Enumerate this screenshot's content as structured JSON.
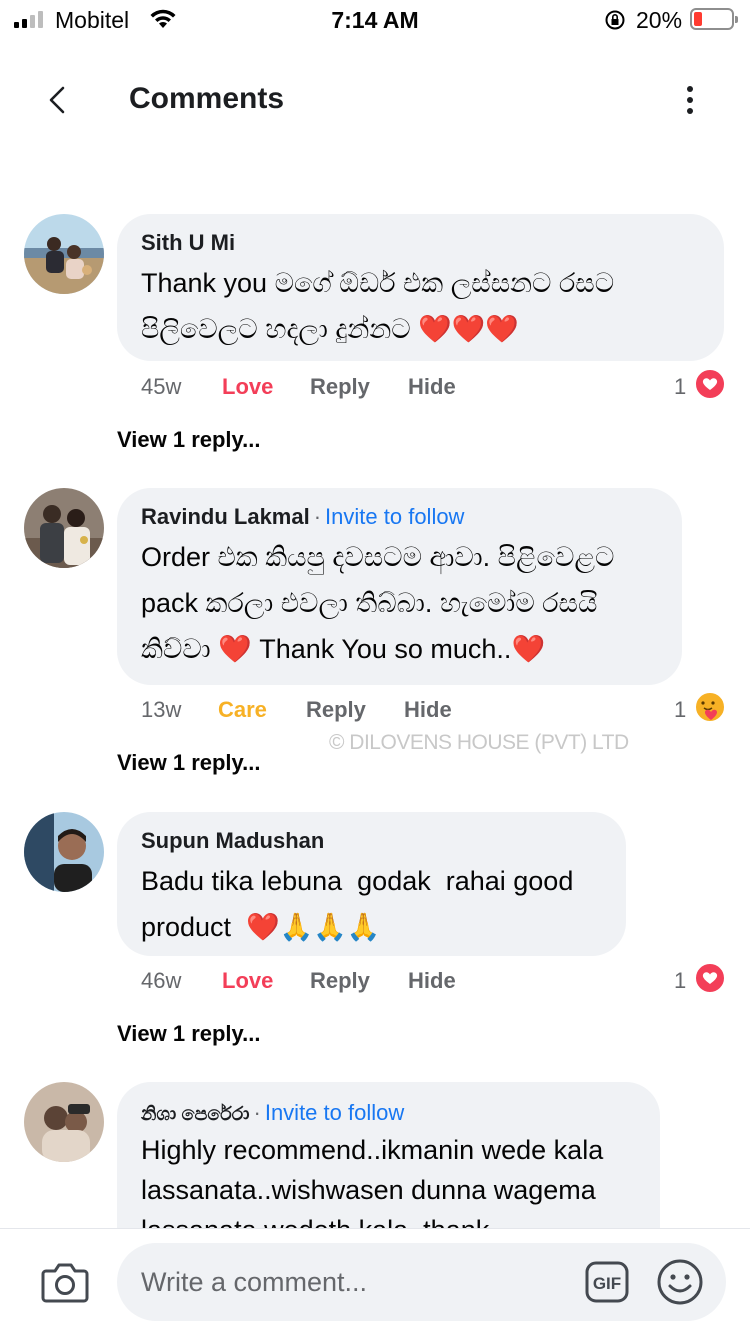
{
  "status_bar": {
    "carrier": "Mobitel",
    "time": "7:14 AM",
    "battery_percent": "20%",
    "battery_level": 0.2,
    "battery_color": "#ff3b30",
    "icons": [
      "signal-icon",
      "wifi-icon",
      "rotation-lock-icon",
      "battery-icon"
    ]
  },
  "header": {
    "title": "Comments",
    "icons": [
      "back-chevron-icon",
      "more-vertical-icon"
    ]
  },
  "comments": [
    {
      "author": "Sith U Mi",
      "invite": "",
      "text": "Thank you මගේ ඕඩර් එක ලස්සනට රසට පිලිවෙලට හදලා දුන්නට ❤️❤️❤️",
      "age": "45w",
      "reaction_label": "Love",
      "reply_label": "Reply",
      "hide_label": "Hide",
      "reaction_count": "1",
      "reaction_icon": "love-reaction-icon",
      "view_replies": "View 1 reply..."
    },
    {
      "author": "Ravindu Lakmal",
      "separator": "·",
      "invite": "Invite to follow",
      "text": "Order එක කියපු දවසටම ආවා. පිළිවෙළට pack කරලා එවලා තිබ්බා. හැමෝම රසයි කිව්වා ❤️ Thank You so much..❤️",
      "age": "13w",
      "reaction_label": "Care",
      "reply_label": "Reply",
      "hide_label": "Hide",
      "reaction_count": "1",
      "reaction_icon": "care-reaction-icon",
      "view_replies": "View 1 reply..."
    },
    {
      "author": "Supun Madushan",
      "invite": "",
      "text": "Badu tika lebuna  godak  rahai good product  ❤️🙏🙏🙏",
      "age": "46w",
      "reaction_label": "Love",
      "reply_label": "Reply",
      "hide_label": "Hide",
      "reaction_count": "1",
      "reaction_icon": "love-reaction-icon",
      "view_replies": "View 1 reply..."
    },
    {
      "author": "නිශා පෙරේරා",
      "separator": "·",
      "invite": "Invite to follow",
      "text": "Highly recommend..ikmanin wede kala lassanata..wishwasen dunna wagema lassanata wedeth kala..thank",
      "age": "",
      "reaction_label": "",
      "reply_label": "",
      "hide_label": "",
      "reaction_count": "",
      "reaction_icon": "",
      "view_replies": ""
    }
  ],
  "watermark": "© DILOVENS HOUSE (PVT) LTD",
  "composer": {
    "placeholder": "Write a comment...",
    "icons": [
      "camera-icon",
      "gif-icon",
      "emoji-icon"
    ]
  },
  "colors": {
    "love": "#f33e58",
    "care": "#f7b125",
    "link": "#1877f2",
    "bubble": "#f0f2f5"
  }
}
